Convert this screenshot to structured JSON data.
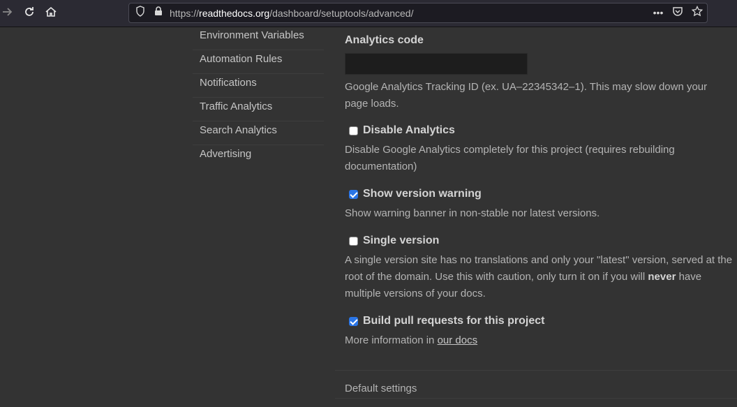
{
  "browser": {
    "url_prefix": "https://",
    "url_host": "readthedocs.org",
    "url_path": "/dashboard/setuptools/advanced/"
  },
  "sidebar": {
    "items": [
      {
        "label": "Environment Variables"
      },
      {
        "label": "Automation Rules"
      },
      {
        "label": "Notifications"
      },
      {
        "label": "Traffic Analytics"
      },
      {
        "label": "Search Analytics"
      },
      {
        "label": "Advertising"
      }
    ]
  },
  "form": {
    "analytics_code": {
      "label": "Analytics code",
      "value": "",
      "help": "Google Analytics Tracking ID (ex. UA–22345342–1). This may slow down your page loads."
    },
    "disable_analytics": {
      "label": "Disable Analytics",
      "checked": false,
      "help": "Disable Google Analytics completely for this project (requires rebuilding documentation)"
    },
    "show_version_warning": {
      "label": "Show version warning",
      "checked": true,
      "help": "Show warning banner in non-stable nor latest versions."
    },
    "single_version": {
      "label": "Single version",
      "checked": false,
      "help_before": "A single version site has no translations and only your \"latest\" version, served at the root of the domain. Use this with caution, only turn it on if you will ",
      "help_strong": "never",
      "help_after": " have multiple versions of your docs."
    },
    "build_pull_requests": {
      "label": "Build pull requests for this project",
      "checked": true,
      "help_before": "More information in ",
      "help_link": "our docs"
    }
  },
  "section": {
    "default_settings": "Default settings"
  }
}
